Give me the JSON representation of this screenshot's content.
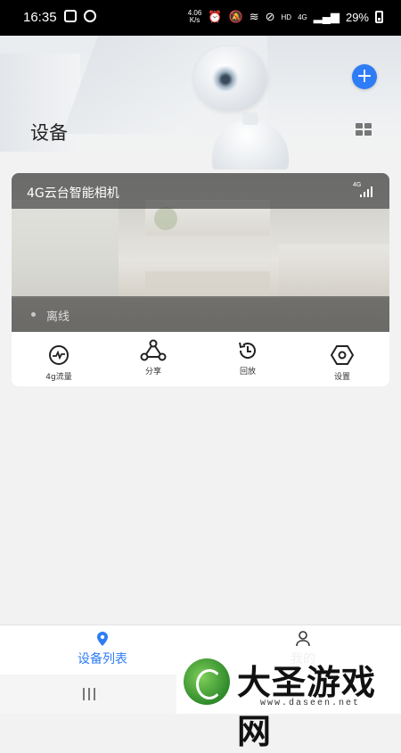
{
  "status_bar": {
    "time": "16:35",
    "speed_value": "4.06",
    "speed_unit": "K/s",
    "hd": "HD",
    "net": "4G",
    "battery": "29%"
  },
  "header": {
    "title": "设备",
    "add_icon": "plus-icon",
    "view_icon": "grid-view-icon",
    "accent": "#2e7df6"
  },
  "device_card": {
    "name": "4G云台智能相机",
    "signal_label": "4G",
    "status": "离线",
    "actions": [
      {
        "label": "4g流量",
        "icon": "traffic-icon"
      },
      {
        "label": "分享",
        "icon": "share-icon"
      },
      {
        "label": "回放",
        "icon": "playback-icon"
      },
      {
        "label": "设置",
        "icon": "settings-icon"
      }
    ]
  },
  "tab_bar": {
    "tabs": [
      {
        "label": "设备列表",
        "icon": "location-pin-icon",
        "active": true
      },
      {
        "label": "我的",
        "icon": "person-icon",
        "active": false
      }
    ]
  },
  "watermark": {
    "text": "大圣游戏网",
    "url": "www.daseen.net"
  }
}
